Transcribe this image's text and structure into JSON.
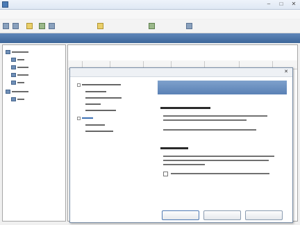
{
  "window": {
    "title": "",
    "controls": {
      "minimize": "–",
      "maximize": "□",
      "close": "✕"
    }
  },
  "menu": [
    {
      "label": ""
    },
    {
      "label": ""
    },
    {
      "label": ""
    },
    {
      "label": ""
    },
    {
      "label": ""
    },
    {
      "label": ""
    },
    {
      "label": ""
    }
  ],
  "toolbar": {
    "items": [
      {
        "icon": "save-icon",
        "label": ""
      },
      {
        "icon": "print-icon",
        "label": ""
      },
      {
        "icon": "help-icon",
        "label": ""
      },
      {
        "icon": "refresh-icon",
        "label": ""
      },
      {
        "icon": "report-icon",
        "label": ""
      },
      {
        "icon": "import-icon",
        "label": ""
      },
      {
        "icon": "export-icon",
        "label": ""
      },
      {
        "icon": "users-icon",
        "label": ""
      }
    ]
  },
  "band": {
    "title": ""
  },
  "sidebar": {
    "items": [
      {
        "level": 0,
        "label": ""
      },
      {
        "level": 1,
        "label": ""
      },
      {
        "level": 1,
        "label": ""
      },
      {
        "level": 1,
        "label": ""
      },
      {
        "level": 1,
        "label": ""
      },
      {
        "level": 0,
        "label": ""
      },
      {
        "level": 1,
        "label": ""
      }
    ]
  },
  "columns": [
    "",
    "",
    "",
    "",
    "",
    "",
    ""
  ],
  "dialog": {
    "title": "",
    "close": "✕",
    "tree": [
      {
        "level": 0,
        "label": "",
        "selected": false
      },
      {
        "level": 1,
        "label": "",
        "selected": false
      },
      {
        "level": 1,
        "label": "",
        "selected": false
      },
      {
        "level": 1,
        "label": "",
        "selected": false
      },
      {
        "level": 1,
        "label": "",
        "selected": false
      },
      {
        "level": 0,
        "label": "",
        "selected": true
      },
      {
        "level": 1,
        "label": "",
        "selected": false
      },
      {
        "level": 1,
        "label": "",
        "selected": false
      }
    ],
    "panel": {
      "header": "",
      "section1": {
        "title": "",
        "text": "",
        "checkbox": ""
      },
      "section2": {
        "title": "",
        "text": "",
        "checkbox": ""
      }
    },
    "buttons": {
      "ok": "",
      "cancel": "",
      "help": ""
    }
  },
  "colors": {
    "accent": "#3d6699",
    "panel_header": "#6a8fc1",
    "selection": "#3b6fb4"
  }
}
